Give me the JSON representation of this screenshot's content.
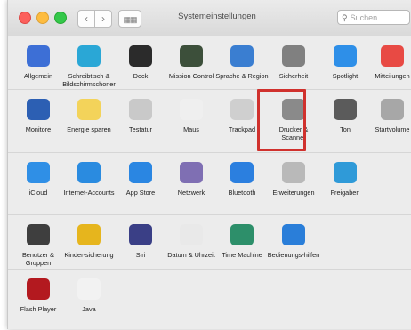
{
  "window": {
    "title": "Systemeinstellungen",
    "search_placeholder": "Suchen"
  },
  "sections": [
    {
      "items": [
        {
          "label": "Allgemein",
          "icon": "general-icon",
          "color": "#3d6fd6"
        },
        {
          "label": "Schreibtisch & Bildschirmschoner",
          "icon": "desktop-icon",
          "color": "#2aa7d6"
        },
        {
          "label": "Dock",
          "icon": "dock-icon",
          "color": "#2b2b2b"
        },
        {
          "label": "Mission Control",
          "icon": "mission-control-icon",
          "color": "#3c4f3a"
        },
        {
          "label": "Sprache & Region",
          "icon": "language-region-icon",
          "color": "#3a7ed1"
        },
        {
          "label": "Sicherheit",
          "icon": "security-icon",
          "color": "#808080"
        },
        {
          "label": "Spotlight",
          "icon": "spotlight-icon",
          "color": "#2e8fe8"
        },
        {
          "label": "Mitteilungen",
          "icon": "notifications-icon",
          "color": "#e84a44"
        }
      ]
    },
    {
      "items": [
        {
          "label": "Monitore",
          "icon": "displays-icon",
          "color": "#2c5fb3"
        },
        {
          "label": "Energie sparen",
          "icon": "energy-saver-icon",
          "color": "#f3d35a"
        },
        {
          "label": "Testatur",
          "icon": "keyboard-icon",
          "color": "#c9c9c9"
        },
        {
          "label": "Maus",
          "icon": "mouse-icon",
          "color": "#efefef"
        },
        {
          "label": "Trackpad",
          "icon": "trackpad-icon",
          "color": "#cfcfcf"
        },
        {
          "label": "Drucker & Scanner",
          "icon": "printer-scanner-icon",
          "color": "#8a8a8a"
        },
        {
          "label": "Ton",
          "icon": "sound-icon",
          "color": "#5b5b5b"
        },
        {
          "label": "Startvolume",
          "icon": "startup-disk-icon",
          "color": "#a7a7a7"
        }
      ]
    },
    {
      "items": [
        {
          "label": "iCloud",
          "icon": "icloud-icon",
          "color": "#2f8fe6"
        },
        {
          "label": "Internet-Accounts",
          "icon": "internet-accounts-icon",
          "color": "#2a8be0"
        },
        {
          "label": "App Store",
          "icon": "app-store-icon",
          "color": "#2a86e2"
        },
        {
          "label": "Netzwerk",
          "icon": "network-icon",
          "color": "#7f6fb3"
        },
        {
          "label": "Bluetooth",
          "icon": "bluetooth-icon",
          "color": "#2b7fdf"
        },
        {
          "label": "Erweiterungen",
          "icon": "extensions-icon",
          "color": "#b9b9b9"
        },
        {
          "label": "Freigaben",
          "icon": "sharing-icon",
          "color": "#2f9ad8"
        }
      ]
    },
    {
      "items": [
        {
          "label": "Benutzer & Gruppen",
          "icon": "users-groups-icon",
          "color": "#3e3e3e"
        },
        {
          "label": "Kinder-sicherung",
          "icon": "parental-controls-icon",
          "color": "#e6b51d"
        },
        {
          "label": "Siri",
          "icon": "siri-icon",
          "color": "#3a3f86"
        },
        {
          "label": "Datum & Uhrzeit",
          "icon": "date-time-icon",
          "color": "#e9e9e9"
        },
        {
          "label": "Time Machine",
          "icon": "time-machine-icon",
          "color": "#2d8f6a"
        },
        {
          "label": "Bedienungs-hilfen",
          "icon": "accessibility-icon",
          "color": "#2a7ed9"
        }
      ]
    },
    {
      "items": [
        {
          "label": "Flash Player",
          "icon": "flash-player-icon",
          "color": "#b3191f"
        },
        {
          "label": "Java",
          "icon": "java-icon",
          "color": "#f2f2f2"
        }
      ]
    }
  ]
}
